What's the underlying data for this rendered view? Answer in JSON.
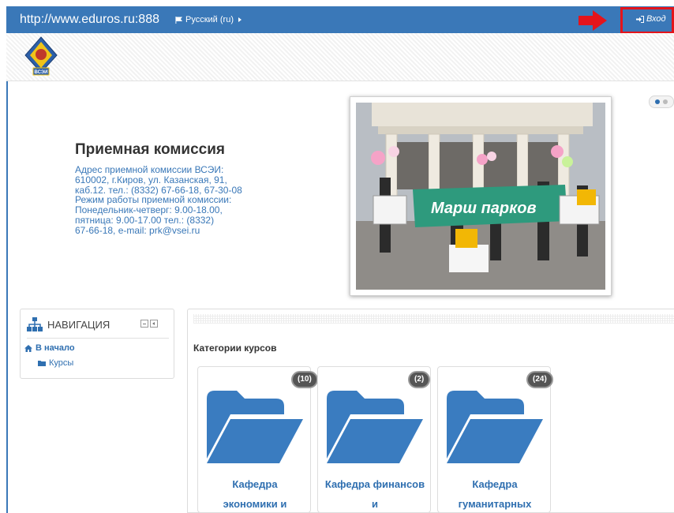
{
  "header": {
    "site_url": "http://www.eduros.ru:888",
    "language": "Русский (ru)",
    "login_label": "Вход"
  },
  "admission": {
    "title": "Приемная комиссия",
    "lines": [
      "Адрес приемной комиссии ВСЭИ:",
      "610002, г.Киров, ул. Казанская, 91,",
      "каб.12. тел.: (8332) 67-66-18, 67-30-08",
      "Режим работы приемной комиссии:",
      "Понедельник-четверг: 9.00-18.00,",
      "пятница: 9.00-17.00 тел.: (8332)",
      "67-66-18, e-mail: prk@vsei.ru"
    ],
    "banner_text": "Марш парков"
  },
  "logo": {
    "text": "ВСЭИ"
  },
  "navigation": {
    "title": "НАВИГАЦИЯ",
    "home": "В начало",
    "courses": "Курсы"
  },
  "main": {
    "heading": "Категории курсов",
    "categories": [
      {
        "count": "(10)",
        "line1": "Кафедра",
        "line2": "экономики и"
      },
      {
        "count": "(2)",
        "line1": "Кафедра финансов",
        "line2": "и"
      },
      {
        "count": "(24)",
        "line1": "Кафедра",
        "line2": "гуманитарных"
      }
    ]
  },
  "icons": {
    "flag": "flag-icon",
    "caret": "caret-right-icon",
    "arrow": "red-arrow-icon",
    "signin": "sign-in-icon",
    "sitemap": "sitemap-icon",
    "home": "home-icon",
    "folder": "folder-open-icon"
  },
  "colors": {
    "navbar": "#3a78b8",
    "link": "#2f6fb0",
    "highlight": "#e4141b",
    "badge": "#555555"
  }
}
